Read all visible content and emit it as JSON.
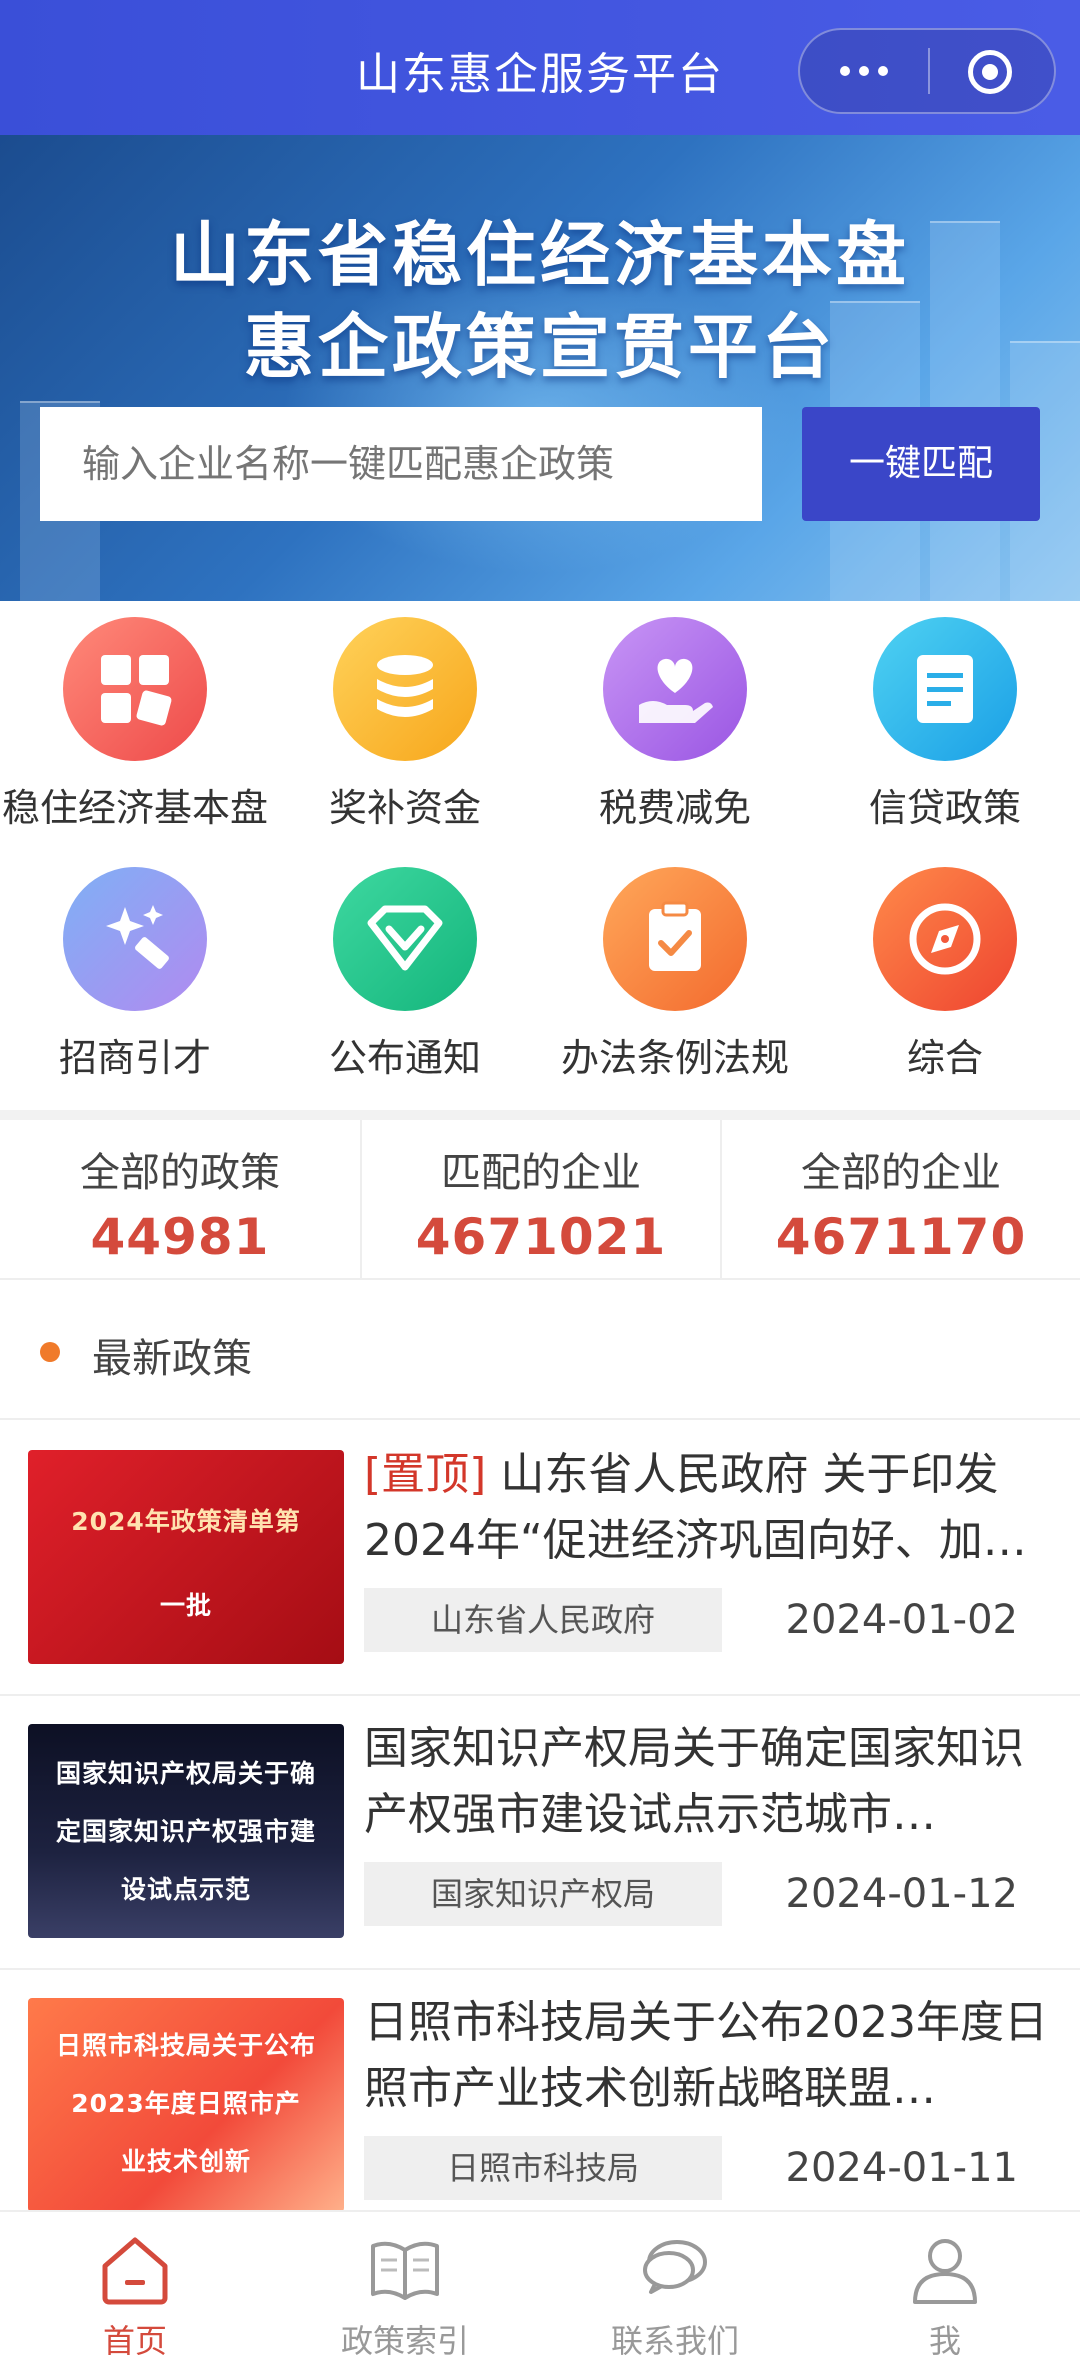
{
  "header": {
    "title": "山东惠企服务平台"
  },
  "banner": {
    "title_line1": "山东省稳住经济基本盘",
    "title_line2": "惠企政策宣贯平台",
    "search_placeholder": "输入企业名称一键匹配惠企政策",
    "match_button": "一键匹配"
  },
  "categories": [
    {
      "label": "稳住经济基本盘",
      "icon": "grid-icon",
      "color": "#f25a5a"
    },
    {
      "label": "奖补资金",
      "icon": "coins-icon",
      "color": "#f5b21e"
    },
    {
      "label": "税费减免",
      "icon": "heart-hand-icon",
      "color": "#a663e8"
    },
    {
      "label": "信贷政策",
      "icon": "document-icon",
      "color": "#22b3e8"
    },
    {
      "label": "招商引才",
      "icon": "sparkle-icon",
      "color": "#8a7ef2"
    },
    {
      "label": "公布通知",
      "icon": "diamond-icon",
      "color": "#1fc08a"
    },
    {
      "label": "办法条例法规",
      "icon": "clipboard-icon",
      "color": "#f77c3a"
    },
    {
      "label": "综合",
      "icon": "compass-icon",
      "color": "#f2583a"
    }
  ],
  "stats": [
    {
      "label": "全部的政策",
      "value": "44981"
    },
    {
      "label": "匹配的企业",
      "value": "4671021"
    },
    {
      "label": "全部的企业",
      "value": "4671170"
    }
  ],
  "section": {
    "title": "最新政策"
  },
  "news": [
    {
      "pin": "[置顶]",
      "title": " 山东省人民政府 关于印发2024年“促进经济巩固向好、加…",
      "source": "山东省人民政府",
      "date": "2024-01-02",
      "thumb_line1": "2024年政策清单第",
      "thumb_line2": "一批"
    },
    {
      "pin": "",
      "title": "国家知识产权局关于确定国家知识产权强市建设试点示范城市…",
      "source": "国家知识产权局",
      "date": "2024-01-12",
      "thumb_line1": "国家知识产权局关于确",
      "thumb_line2": "定国家知识产权强市建",
      "thumb_line3": "设试点示范"
    },
    {
      "pin": "",
      "title": "日照市科技局关于公布2023年度日照市产业技术创新战略联盟…",
      "source": "日照市科技局",
      "date": "2024-01-11",
      "thumb_line1": "日照市科技局关于公布",
      "thumb_line2": "2023年度日照市产",
      "thumb_line3": "业技术创新"
    }
  ],
  "tabbar": [
    {
      "label": "首页",
      "icon": "home-icon",
      "active": true
    },
    {
      "label": "政策索引",
      "icon": "book-icon",
      "active": false
    },
    {
      "label": "联系我们",
      "icon": "chat-icon",
      "active": false
    },
    {
      "label": "我",
      "icon": "user-icon",
      "active": false
    }
  ]
}
